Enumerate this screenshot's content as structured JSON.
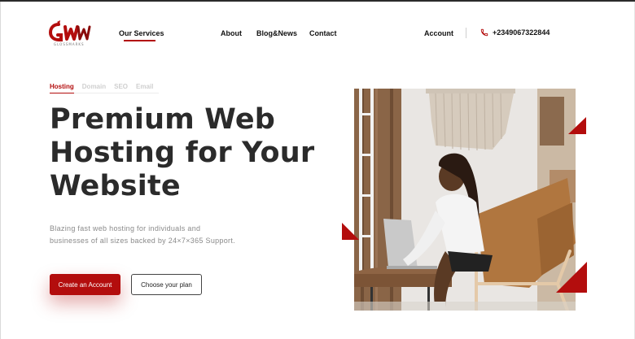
{
  "brand": {
    "logo_sub": "GLOSSMARKS"
  },
  "nav": {
    "services": "Our Services",
    "about": "About",
    "blog": "Blog&News",
    "contact": "Contact",
    "account": "Account",
    "phone": "+2349067322844"
  },
  "tabs": [
    "Hosting",
    "Domain",
    "SEO",
    "Email"
  ],
  "hero": {
    "title_lines": [
      "Premium Web",
      "Hosting for Your",
      "Website"
    ],
    "desc_lines": [
      "Blazing fast web hosting for individuals and",
      "businesses of all sizes backed by 24×7×365 Support."
    ],
    "primary_cta": "Create an Account",
    "secondary_cta": "Choose your plan"
  },
  "colors": {
    "accent": "#b30d0d",
    "heading": "#2b2b2b",
    "muted": "#8a8a8a"
  },
  "icons": {
    "phone": "phone-icon",
    "logo": "brand-logo-icon"
  }
}
